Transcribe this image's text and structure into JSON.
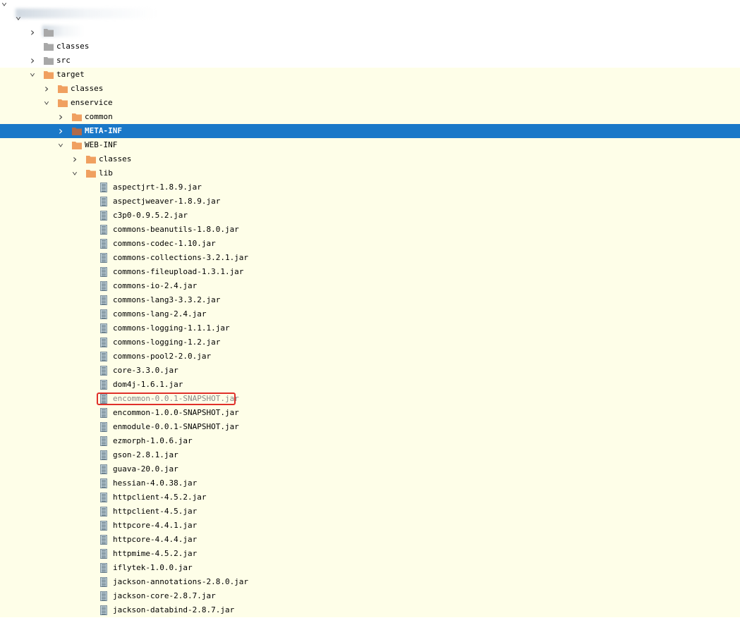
{
  "colors": {
    "folder_orange": "#f0a060",
    "folder_gray": "#a8a8a8",
    "selected_bg": "#1a78c8",
    "excluded_bg": "#fefee8",
    "highlight_box": "#e0302a"
  },
  "tree": [
    {
      "id": "root",
      "label": "",
      "level": 0,
      "icon": "none",
      "arrow": "down",
      "bg": "normal"
    },
    {
      "id": "module",
      "label": "",
      "level": 1,
      "icon": "none",
      "arrow": "down",
      "bg": "normal"
    },
    {
      "id": "blurred-child",
      "label": "",
      "level": 2,
      "icon": "folder-gray",
      "arrow": "right",
      "bg": "normal"
    },
    {
      "id": "classes-top",
      "label": "classes",
      "level": 2,
      "icon": "folder-gray",
      "arrow": "none",
      "bg": "normal"
    },
    {
      "id": "src",
      "label": "src",
      "level": 2,
      "icon": "folder-gray",
      "arrow": "right",
      "bg": "normal"
    },
    {
      "id": "target",
      "label": "target",
      "level": 2,
      "icon": "folder-orange",
      "arrow": "down",
      "bg": "excluded"
    },
    {
      "id": "target-classes",
      "label": "classes",
      "level": 3,
      "icon": "folder-orange",
      "arrow": "right",
      "bg": "excluded"
    },
    {
      "id": "enservice",
      "label": "enservice",
      "level": 3,
      "icon": "folder-orange",
      "arrow": "down",
      "bg": "excluded"
    },
    {
      "id": "common",
      "label": "common",
      "level": 4,
      "icon": "folder-orange",
      "arrow": "right",
      "bg": "excluded"
    },
    {
      "id": "meta-inf",
      "label": "META-INF",
      "level": 4,
      "icon": "folder-orange",
      "arrow": "right",
      "bg": "selected"
    },
    {
      "id": "web-inf",
      "label": "WEB-INF",
      "level": 4,
      "icon": "folder-orange",
      "arrow": "down",
      "bg": "excluded"
    },
    {
      "id": "webinf-classes",
      "label": "classes",
      "level": 5,
      "icon": "folder-orange",
      "arrow": "right",
      "bg": "excluded"
    },
    {
      "id": "lib",
      "label": "lib",
      "level": 5,
      "icon": "folder-orange",
      "arrow": "down",
      "bg": "excluded"
    },
    {
      "id": "jar-1",
      "label": "aspectjrt-1.8.9.jar",
      "level": 6,
      "icon": "jar",
      "arrow": "none",
      "bg": "excluded"
    },
    {
      "id": "jar-2",
      "label": "aspectjweaver-1.8.9.jar",
      "level": 6,
      "icon": "jar",
      "arrow": "none",
      "bg": "excluded"
    },
    {
      "id": "jar-3",
      "label": "c3p0-0.9.5.2.jar",
      "level": 6,
      "icon": "jar",
      "arrow": "none",
      "bg": "excluded"
    },
    {
      "id": "jar-4",
      "label": "commons-beanutils-1.8.0.jar",
      "level": 6,
      "icon": "jar",
      "arrow": "none",
      "bg": "excluded"
    },
    {
      "id": "jar-5",
      "label": "commons-codec-1.10.jar",
      "level": 6,
      "icon": "jar",
      "arrow": "none",
      "bg": "excluded"
    },
    {
      "id": "jar-6",
      "label": "commons-collections-3.2.1.jar",
      "level": 6,
      "icon": "jar",
      "arrow": "none",
      "bg": "excluded"
    },
    {
      "id": "jar-7",
      "label": "commons-fileupload-1.3.1.jar",
      "level": 6,
      "icon": "jar",
      "arrow": "none",
      "bg": "excluded"
    },
    {
      "id": "jar-8",
      "label": "commons-io-2.4.jar",
      "level": 6,
      "icon": "jar",
      "arrow": "none",
      "bg": "excluded"
    },
    {
      "id": "jar-9",
      "label": "commons-lang3-3.3.2.jar",
      "level": 6,
      "icon": "jar",
      "arrow": "none",
      "bg": "excluded"
    },
    {
      "id": "jar-10",
      "label": "commons-lang-2.4.jar",
      "level": 6,
      "icon": "jar",
      "arrow": "none",
      "bg": "excluded"
    },
    {
      "id": "jar-11",
      "label": "commons-logging-1.1.1.jar",
      "level": 6,
      "icon": "jar",
      "arrow": "none",
      "bg": "excluded"
    },
    {
      "id": "jar-12",
      "label": "commons-logging-1.2.jar",
      "level": 6,
      "icon": "jar",
      "arrow": "none",
      "bg": "excluded"
    },
    {
      "id": "jar-13",
      "label": "commons-pool2-2.0.jar",
      "level": 6,
      "icon": "jar",
      "arrow": "none",
      "bg": "excluded"
    },
    {
      "id": "jar-14",
      "label": "core-3.3.0.jar",
      "level": 6,
      "icon": "jar",
      "arrow": "none",
      "bg": "excluded"
    },
    {
      "id": "jar-15",
      "label": "dom4j-1.6.1.jar",
      "level": 6,
      "icon": "jar",
      "arrow": "none",
      "bg": "excluded"
    },
    {
      "id": "jar-16",
      "label": "encommon-0.0.1-SNAPSHOT.jar",
      "level": 6,
      "icon": "jar",
      "arrow": "none",
      "bg": "excluded",
      "dim": true,
      "highlighted": true
    },
    {
      "id": "jar-17",
      "label": "encommon-1.0.0-SNAPSHOT.jar",
      "level": 6,
      "icon": "jar",
      "arrow": "none",
      "bg": "excluded"
    },
    {
      "id": "jar-18",
      "label": "enmodule-0.0.1-SNAPSHOT.jar",
      "level": 6,
      "icon": "jar",
      "arrow": "none",
      "bg": "excluded"
    },
    {
      "id": "jar-19",
      "label": "ezmorph-1.0.6.jar",
      "level": 6,
      "icon": "jar",
      "arrow": "none",
      "bg": "excluded"
    },
    {
      "id": "jar-20",
      "label": "gson-2.8.1.jar",
      "level": 6,
      "icon": "jar",
      "arrow": "none",
      "bg": "excluded"
    },
    {
      "id": "jar-21",
      "label": "guava-20.0.jar",
      "level": 6,
      "icon": "jar",
      "arrow": "none",
      "bg": "excluded"
    },
    {
      "id": "jar-22",
      "label": "hessian-4.0.38.jar",
      "level": 6,
      "icon": "jar",
      "arrow": "none",
      "bg": "excluded"
    },
    {
      "id": "jar-23",
      "label": "httpclient-4.5.2.jar",
      "level": 6,
      "icon": "jar",
      "arrow": "none",
      "bg": "excluded"
    },
    {
      "id": "jar-24",
      "label": "httpclient-4.5.jar",
      "level": 6,
      "icon": "jar",
      "arrow": "none",
      "bg": "excluded"
    },
    {
      "id": "jar-25",
      "label": "httpcore-4.4.1.jar",
      "level": 6,
      "icon": "jar",
      "arrow": "none",
      "bg": "excluded"
    },
    {
      "id": "jar-26",
      "label": "httpcore-4.4.4.jar",
      "level": 6,
      "icon": "jar",
      "arrow": "none",
      "bg": "excluded"
    },
    {
      "id": "jar-27",
      "label": "httpmime-4.5.2.jar",
      "level": 6,
      "icon": "jar",
      "arrow": "none",
      "bg": "excluded"
    },
    {
      "id": "jar-28",
      "label": "iflytek-1.0.0.jar",
      "level": 6,
      "icon": "jar",
      "arrow": "none",
      "bg": "excluded"
    },
    {
      "id": "jar-29",
      "label": "jackson-annotations-2.8.0.jar",
      "level": 6,
      "icon": "jar",
      "arrow": "none",
      "bg": "excluded"
    },
    {
      "id": "jar-30",
      "label": "jackson-core-2.8.7.jar",
      "level": 6,
      "icon": "jar",
      "arrow": "none",
      "bg": "excluded"
    },
    {
      "id": "jar-31",
      "label": "jackson-databind-2.8.7.jar",
      "level": 6,
      "icon": "jar",
      "arrow": "none",
      "bg": "excluded"
    }
  ]
}
